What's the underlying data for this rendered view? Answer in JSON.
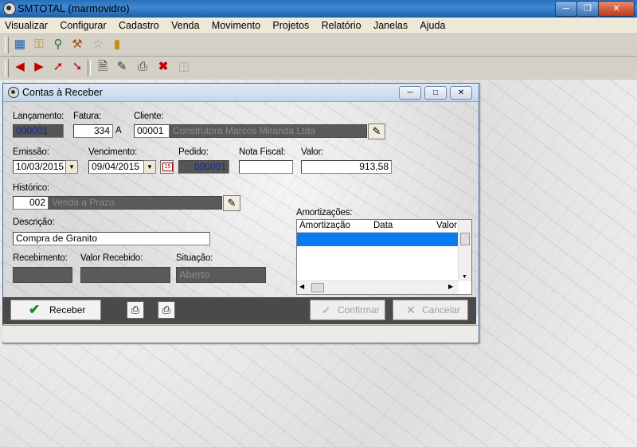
{
  "window": {
    "title": "SMTOTAL (marmovidro)"
  },
  "menu": [
    "Visualizar",
    "Configurar",
    "Cadastro",
    "Venda",
    "Movimento",
    "Projetos",
    "Relatório",
    "Janelas",
    "Ajuda"
  ],
  "dialog": {
    "title": "Contas à Receber",
    "labels": {
      "lancamento": "Lançamento:",
      "fatura": "Fatura:",
      "cliente": "Cliente:",
      "emissao": "Emissão:",
      "vencimento": "Vencimento:",
      "pedido": "Pedido:",
      "nota_fiscal": "Nota Fiscal:",
      "valor": "Valor:",
      "historico": "Histórico:",
      "descricao": "Descrição:",
      "recebimento": "Recebimento:",
      "valor_recebido": "Valor Recebido:",
      "situacao": "Situação:",
      "amortizacoes": "Amortizações:"
    },
    "values": {
      "lancamento": "000001",
      "fatura_num": "334",
      "fatura_suffix": "A",
      "cliente_code": "00001",
      "cliente_name": "Construtora Marcos Miranda Ltda",
      "emissao": "10/03/2015",
      "vencimento": "09/04/2015",
      "pedido": "000001",
      "nota_fiscal": "",
      "valor": "913,58",
      "historico_code": "002",
      "historico_name": "Venda a Prazo",
      "descricao": "Compra de Granito",
      "recebimento": "",
      "valor_recebido": "",
      "situacao": "Aberto"
    },
    "amortizacoes_columns": [
      "Amortização",
      "Data",
      "Valor"
    ],
    "buttons": {
      "receber": "Receber",
      "confirmar": "Confirmar",
      "cancelar": "Cancelar"
    }
  }
}
